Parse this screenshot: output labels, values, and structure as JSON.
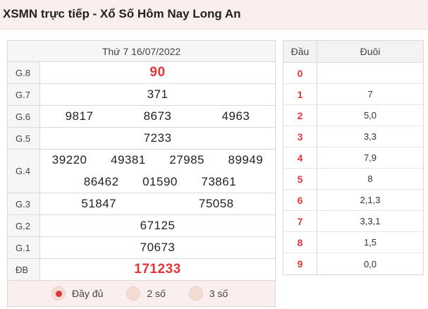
{
  "header": {
    "title": "XSMN trực tiếp - Xổ Số Hôm Nay Long An"
  },
  "results": {
    "date": "Thứ 7 16/07/2022",
    "prizes": {
      "g8": {
        "label": "G.8",
        "numbers": [
          "90"
        ]
      },
      "g7": {
        "label": "G.7",
        "numbers": [
          "371"
        ]
      },
      "g6": {
        "label": "G.6",
        "numbers": [
          "9817",
          "8673",
          "4963"
        ]
      },
      "g5": {
        "label": "G.5",
        "numbers": [
          "7233"
        ]
      },
      "g4": {
        "label": "G.4",
        "numbers": [
          "39220",
          "49381",
          "27985",
          "89949",
          "86462",
          "01590",
          "73861"
        ]
      },
      "g3": {
        "label": "G.3",
        "numbers": [
          "51847",
          "75058"
        ]
      },
      "g2": {
        "label": "G.2",
        "numbers": [
          "67125"
        ]
      },
      "g1": {
        "label": "G.1",
        "numbers": [
          "70673"
        ]
      },
      "db": {
        "label": "ĐB",
        "numbers": [
          "171233"
        ]
      }
    },
    "filters": [
      {
        "label": "Đầy đủ",
        "checked": true
      },
      {
        "label": "2 số",
        "checked": false
      },
      {
        "label": "3 số",
        "checked": false
      }
    ]
  },
  "loto": {
    "head_label": "Đầu",
    "tail_label": "Đuôi",
    "rows": [
      {
        "head": "0",
        "tail": ""
      },
      {
        "head": "1",
        "tail": "7"
      },
      {
        "head": "2",
        "tail": "5,0"
      },
      {
        "head": "3",
        "tail": "3,3"
      },
      {
        "head": "4",
        "tail": "7,9"
      },
      {
        "head": "5",
        "tail": "8"
      },
      {
        "head": "6",
        "tail": "2,1,3"
      },
      {
        "head": "7",
        "tail": "3,3,1"
      },
      {
        "head": "8",
        "tail": "1,5"
      },
      {
        "head": "9",
        "tail": "0,0"
      }
    ]
  },
  "colors": {
    "accent": "#e0363a",
    "header_bg": "#fbeeee"
  }
}
